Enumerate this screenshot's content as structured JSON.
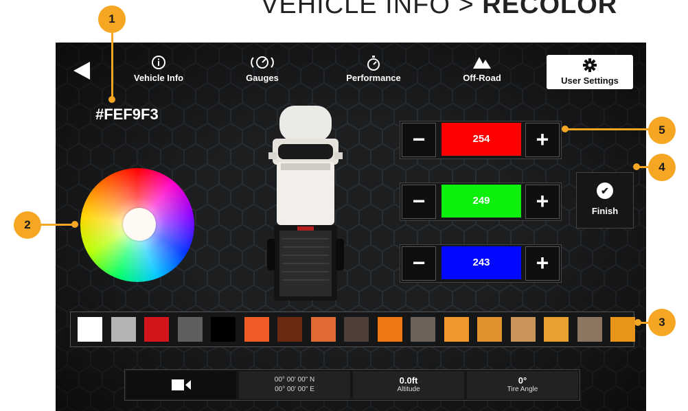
{
  "page_title": {
    "prefix": "VEHICLE INFO > ",
    "bold": "RECOLOR"
  },
  "nav": {
    "items": [
      {
        "label": "Vehicle Info",
        "icon": "info-icon"
      },
      {
        "label": "Gauges",
        "icon": "gauge-icon"
      },
      {
        "label": "Performance",
        "icon": "stopwatch-icon"
      },
      {
        "label": "Off-Road",
        "icon": "mountain-icon"
      }
    ],
    "user_settings": {
      "label": "User Settings",
      "icon": "gear-icon"
    }
  },
  "color": {
    "hex": "#FEF9F3",
    "red": "254",
    "green": "249",
    "blue": "243",
    "minus": "−",
    "plus": "+"
  },
  "finish": {
    "label": "Finish"
  },
  "swatches": [
    "#ffffff",
    "#b4b4b4",
    "#d2161a",
    "#5f5f5f",
    "#000000",
    "#f05a24",
    "#6b2a10",
    "#e06a36",
    "#4e4038",
    "#f07814",
    "#6c6258",
    "#f0962a",
    "#e0922e",
    "#c9945a",
    "#e8a032",
    "#8c7660",
    "#e89418"
  ],
  "status": {
    "lat": "00° 00' 00\" N",
    "lon": "00° 00' 00\" E",
    "altitude_value": "0.0ft",
    "altitude_label": "Altitude",
    "tire_value": "0°",
    "tire_label": "Tire Angle"
  },
  "callouts": [
    "1",
    "2",
    "3",
    "4",
    "5"
  ],
  "colors": {
    "accent": "#f5a623",
    "red_field": "#ff0000",
    "green_field": "#0cf00c",
    "blue_field": "#0008ff"
  }
}
